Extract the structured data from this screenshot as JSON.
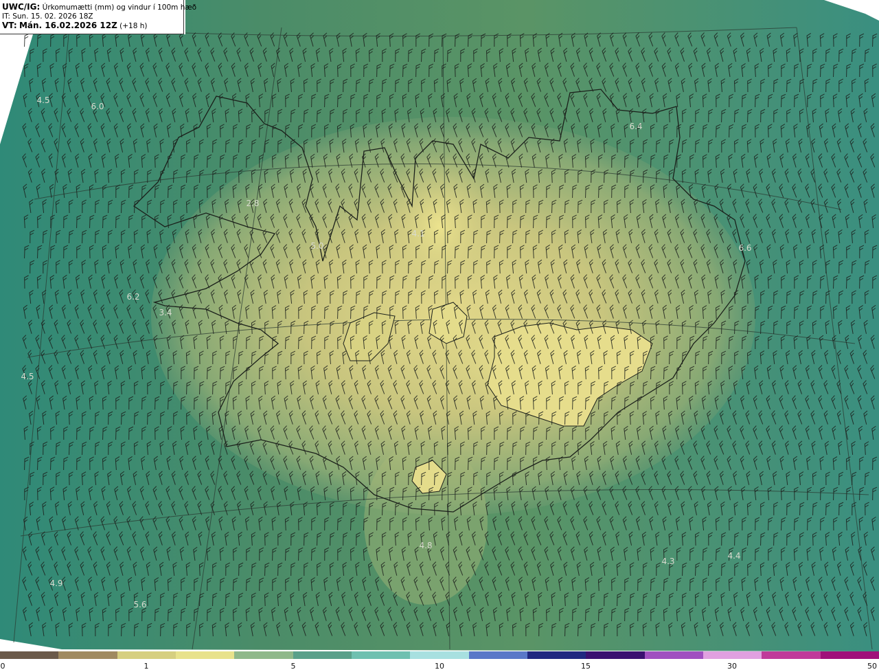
{
  "header": {
    "model": "UWC/IG:",
    "title": "Úrkomumætti (mm) og vindur í 100m hæð",
    "it_line": "IT: Sun. 15. 02. 2026 18Z",
    "vt_prefix": "VT:",
    "vt_bold": "Mán. 16.02.2026 12Z",
    "vt_suffix": "(+18 h)"
  },
  "value_labels": [
    "4.5",
    "6.0",
    "2.8",
    "5.0",
    "4.1",
    "6.4",
    "6.6",
    "6.2",
    "3.4",
    "4.5",
    "4.8",
    "4.3",
    "4.4",
    "4.9",
    "5.6"
  ],
  "colorbar": {
    "ticks": [
      "0",
      "1",
      "5",
      "10",
      "15",
      "30",
      "50"
    ],
    "colors": [
      "#6b5a4a",
      "#a08a60",
      "#d6cf80",
      "#e8e28c",
      "#8fb88a",
      "#5aa08a",
      "#6fc0b0",
      "#a8e0e0",
      "#5a78c8",
      "#202880",
      "#3a1070",
      "#a050c0",
      "#e0a0e0",
      "#c03a9a",
      "#a0107a"
    ]
  }
}
